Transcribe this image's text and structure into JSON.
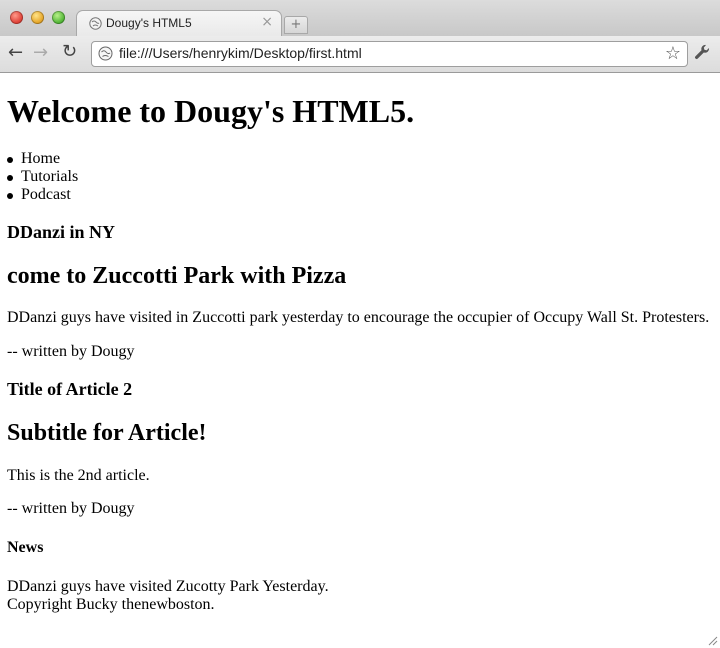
{
  "window": {
    "tab_title": "Dougy's HTML5",
    "tab_close": "×",
    "new_tab": "+"
  },
  "toolbar": {
    "back": "←",
    "forward": "→",
    "reload": "↻",
    "url": "file:///Users/henrykim/Desktop/first.html",
    "star": "☆"
  },
  "page": {
    "heading": "Welcome to Dougy's HTML5.",
    "nav": [
      "Home",
      "Tutorials",
      "Podcast"
    ],
    "article1": {
      "title": "DDanzi in NY",
      "subtitle": "come to Zuccotti Park with Pizza",
      "body": "DDanzi guys have visited in Zuccotti park yesterday to encourage the occupier of Occupy Wall St. Protesters.",
      "byline": "-- written by Dougy"
    },
    "article2": {
      "title": "Title of Article 2",
      "subtitle": "Subtitle for Article!",
      "body": "This is the 2nd article.",
      "byline": "-- written by Dougy"
    },
    "aside": {
      "title": "News",
      "body": "DDanzi guys have visited Zucotty Park Yesterday."
    },
    "footer": "Copyright Bucky thenewboston."
  }
}
